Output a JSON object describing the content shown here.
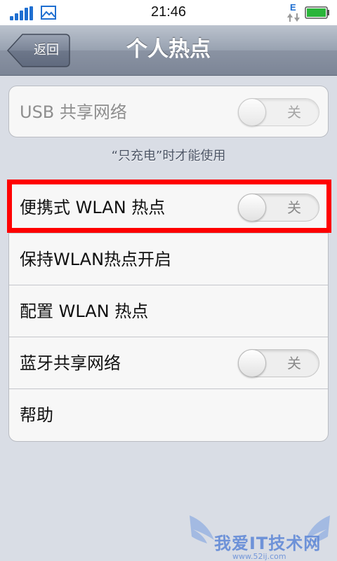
{
  "status_bar": {
    "time": "21:46",
    "network_letter": "E",
    "signal_icon": "signal-bars-icon",
    "image_icon": "image-icon",
    "battery_icon": "battery-full-icon",
    "accent_color": "#1f6fd1"
  },
  "nav": {
    "back_label": "返回",
    "title": "个人热点"
  },
  "usb_group": {
    "label": "USB 共享网络",
    "toggle": "关",
    "enabled": false
  },
  "footnote": "“只充电”时才能使用",
  "main_group": {
    "rows": [
      {
        "label": "便携式 WLAN 热点",
        "toggle": "关"
      },
      {
        "label": "保持WLAN热点开启"
      },
      {
        "label": "配置 WLAN 热点"
      },
      {
        "label": "蓝牙共享网络",
        "toggle": "关"
      },
      {
        "label": "帮助"
      }
    ]
  },
  "highlight_color": "#ff0000",
  "watermark": {
    "text": "我爱IT技术网",
    "url": "www.52ij.com"
  }
}
